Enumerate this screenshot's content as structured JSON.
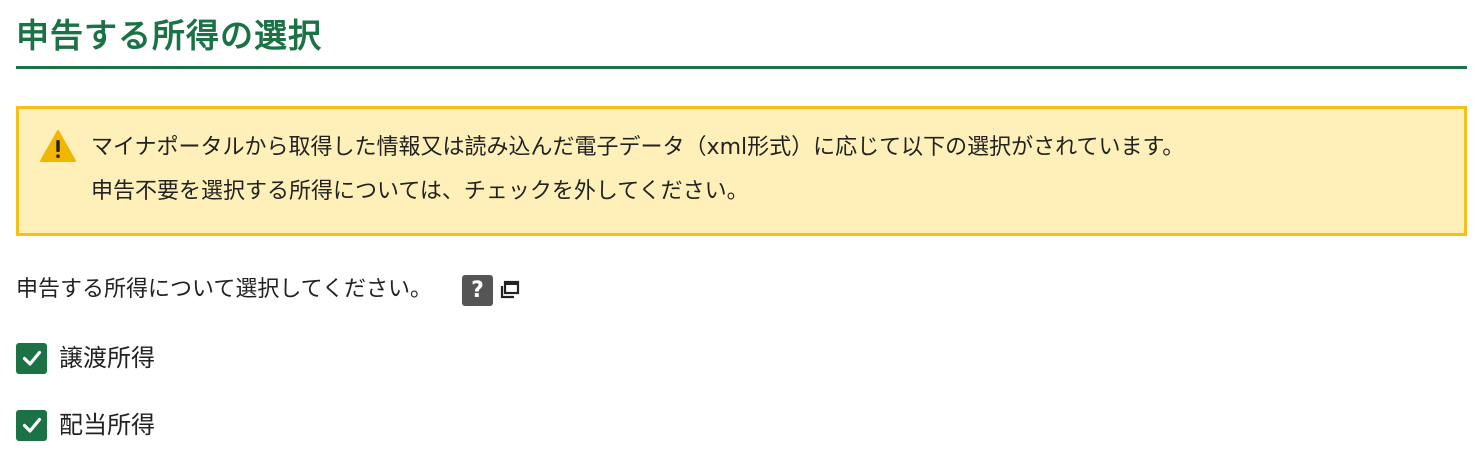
{
  "page": {
    "title": "申告する所得の選択"
  },
  "notice": {
    "icon": "warning-icon",
    "line1": "マイナポータルから取得した情報又は読み込んだ電子データ（xml形式）に応じて以下の選択がされています。",
    "line2": "申告不要を選択する所得については、チェックを外してください。",
    "colors": {
      "background": "#fef0b8",
      "border": "#f2c21b"
    }
  },
  "prompt": {
    "text": "申告する所得について選択してください。",
    "help_label": "?",
    "help_icon": "question-icon",
    "new_window_icon": "new-window-icon"
  },
  "income_options": [
    {
      "label": "譲渡所得",
      "checked": true
    },
    {
      "label": "配当所得",
      "checked": true
    }
  ],
  "colors": {
    "accent": "#1a7245",
    "help_button": "#555555"
  }
}
